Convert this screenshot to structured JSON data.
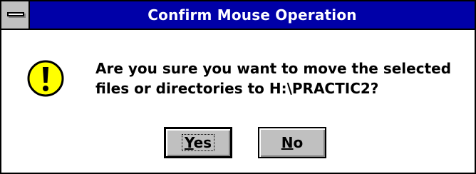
{
  "window": {
    "title": "Confirm Mouse Operation"
  },
  "message": {
    "line1": "Are you sure you want to move the selected",
    "line2": "files or directories to H:\\PRACTIC2?"
  },
  "icon": {
    "name": "warning-exclamation-icon",
    "color": "#ffff00"
  },
  "buttons": {
    "yes": {
      "mnemonic": "Y",
      "rest": "es"
    },
    "no": {
      "mnemonic": "N",
      "rest": "o"
    }
  }
}
